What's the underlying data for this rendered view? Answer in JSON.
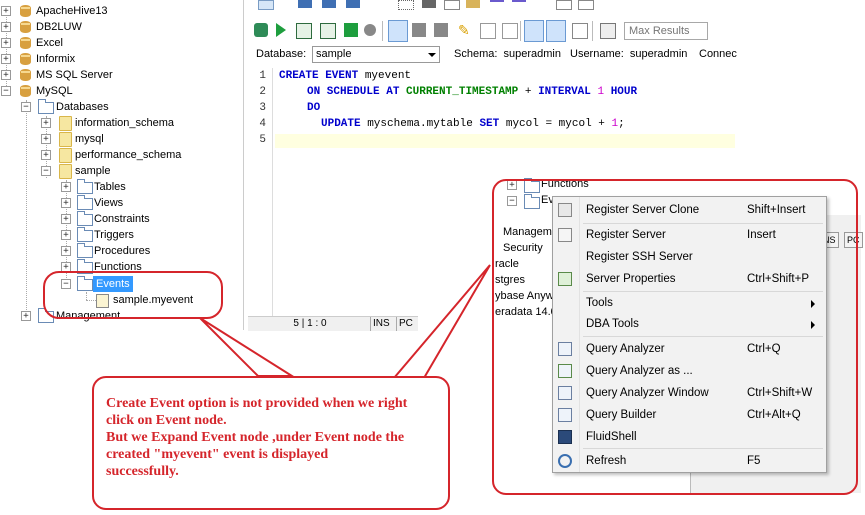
{
  "tree": {
    "connections": [
      {
        "label": "ApacheHive13"
      },
      {
        "label": "DB2LUW"
      },
      {
        "label": "Excel"
      },
      {
        "label": "Informix"
      },
      {
        "label": "MS SQL Server"
      },
      {
        "label": "MySQL"
      }
    ],
    "databases_label": "Databases",
    "schemas": [
      "information_schema",
      "mysql",
      "performance_schema",
      "sample"
    ],
    "sample_children": [
      "Tables",
      "Views",
      "Constraints",
      "Triggers",
      "Procedures",
      "Functions"
    ],
    "events_label": "Events",
    "event_item": "sample.myevent",
    "management_label": "Management"
  },
  "editor": {
    "max_results_placeholder": "Max Results",
    "database_label": "Database:",
    "database_value": "sample",
    "schema_text": "Schema:  superadmin",
    "username_text": "Username:  superadmin",
    "connect_text": "Connec",
    "line_numbers": [
      "1",
      "2",
      "3",
      "4",
      "5"
    ],
    "code": {
      "l1_a": "CREATE EVENT",
      "l1_b": " myevent",
      "l2_a": "ON SCHEDULE AT",
      "l2_b": "CURRENT_TIMESTAMP",
      "l2_c": " + ",
      "l2_d": "INTERVAL",
      "l2_e": "1",
      "l2_f": "HOUR",
      "l3": "DO",
      "l4_a": "UPDATE",
      "l4_b": " myschema.mytable ",
      "l4_c": "SET",
      "l4_d": " mycol = mycol + ",
      "l4_e": "1",
      "l4_f": ";"
    },
    "status": {
      "position": "5 | 1 : 0",
      "ins": "INS",
      "pc": "PC"
    }
  },
  "right_tree": {
    "functions": "Functions",
    "events_partial": "Eve",
    "management_partial": "Manageme",
    "security": "Security",
    "oracle_partial": "racle",
    "postgres_partial": "stgres",
    "sybase_partial": "ybase Anywh",
    "teradata_partial": "eradata 14.0",
    "tabs": [
      "NS",
      "PC"
    ]
  },
  "context_menu": {
    "items": [
      {
        "label": "Register Server Clone",
        "shortcut": "Shift+Insert",
        "icon": "server-clone-icon"
      },
      {
        "label": "Register Server",
        "shortcut": "Insert",
        "icon": "register-server-icon"
      },
      {
        "label": "Register SSH Server",
        "shortcut": "",
        "icon": ""
      },
      {
        "label": "Server Properties",
        "shortcut": "Ctrl+Shift+P",
        "icon": "properties-icon"
      },
      {
        "label": "Tools",
        "shortcut": "",
        "icon": "",
        "submenu": true
      },
      {
        "label": "DBA Tools",
        "shortcut": "",
        "icon": "",
        "submenu": true
      },
      {
        "label": "Query Analyzer",
        "shortcut": "Ctrl+Q",
        "icon": "query-analyzer-icon"
      },
      {
        "label": "Query Analyzer as ...",
        "shortcut": "",
        "icon": "query-analyzer-as-icon"
      },
      {
        "label": "Query Analyzer Window",
        "shortcut": "Ctrl+Shift+W",
        "icon": "query-window-icon"
      },
      {
        "label": "Query Builder",
        "shortcut": "Ctrl+Alt+Q",
        "icon": "query-builder-icon"
      },
      {
        "label": "FluidShell",
        "shortcut": "",
        "icon": "fluidshell-icon"
      },
      {
        "label": "Refresh",
        "shortcut": "F5",
        "icon": "refresh-icon"
      }
    ]
  },
  "annotation": {
    "line1": "Create Event option is not provided when we right",
    "line2": "click on Event node.",
    "line3": "But we Expand Event node ,under Event node the",
    "line4": "created \"myevent\" event is displayed",
    "line5": "successfully."
  },
  "colors": {
    "annotation_red": "#d5252b",
    "keyword_blue": "#0000cc",
    "function_green": "#008000",
    "number_magenta": "#cc00cc",
    "selection_blue": "#3399ff"
  }
}
